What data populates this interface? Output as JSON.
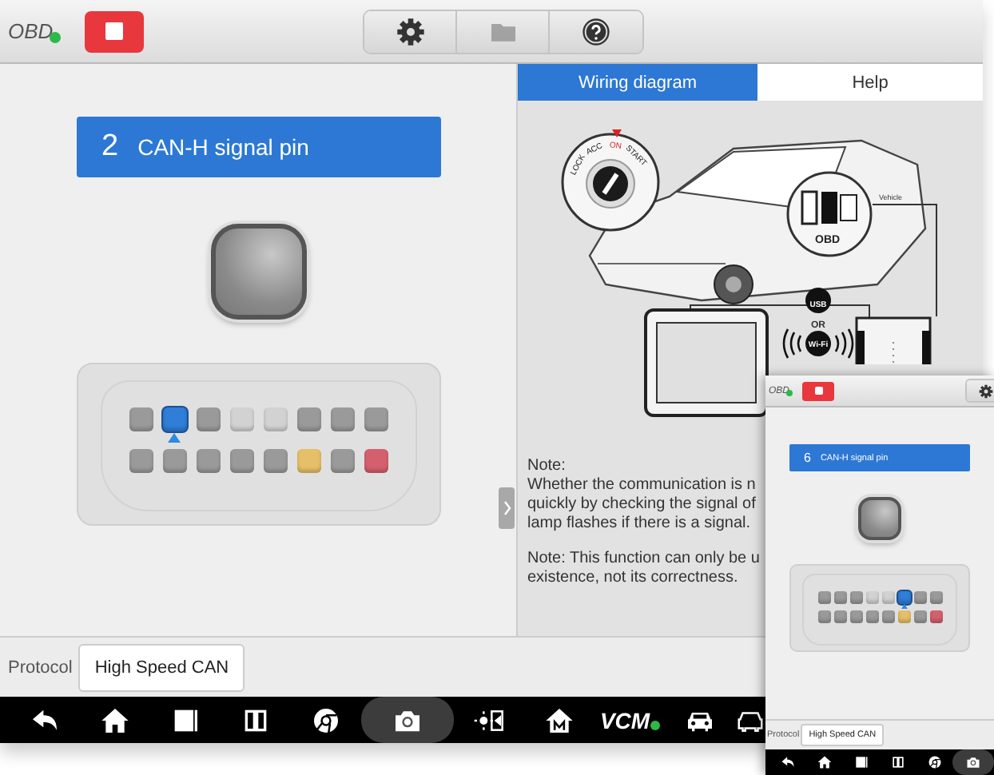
{
  "top_bar": {
    "connection_label": "OBD",
    "connected": true,
    "toolbar": [
      {
        "kind": "settings",
        "disabled": false
      },
      {
        "kind": "folder",
        "disabled": true
      },
      {
        "kind": "help",
        "disabled": false
      }
    ]
  },
  "left_panel": {
    "pin_number": "2",
    "pin_label": "CAN-H signal pin",
    "connector": {
      "pins": [
        {
          "color": "#9a9a9a",
          "selected": false
        },
        {
          "color": "#2f7fd8",
          "selected": true
        },
        {
          "color": "#9a9a9a",
          "selected": false
        },
        {
          "color": "#d2d2d2",
          "selected": false
        },
        {
          "color": "#d2d2d2",
          "selected": false
        },
        {
          "color": "#9a9a9a",
          "selected": false
        },
        {
          "color": "#9a9a9a",
          "selected": false
        },
        {
          "color": "#9a9a9a",
          "selected": false
        },
        {
          "color": "#9a9a9a",
          "selected": false
        },
        {
          "color": "#9a9a9a",
          "selected": false
        },
        {
          "color": "#9a9a9a",
          "selected": false
        },
        {
          "color": "#9a9a9a",
          "selected": false
        },
        {
          "color": "#9a9a9a",
          "selected": false
        },
        {
          "color": "#e6c068",
          "selected": false
        },
        {
          "color": "#9a9a9a",
          "selected": false
        },
        {
          "color": "#d4606e",
          "selected": false
        }
      ]
    }
  },
  "right_panel": {
    "tabs": [
      {
        "label": "Wiring diagram",
        "selected": true
      },
      {
        "label": "Help",
        "selected": false
      }
    ],
    "diagram": {
      "ignition_positions": [
        "LOCK",
        "ACC",
        "ON",
        "START"
      ],
      "port_label": "OBD",
      "cable_label": "Vehicle",
      "usb_label": "USB",
      "or_label": "OR",
      "wifi_label": "Wi-Fi"
    },
    "notes": [
      {
        "lines": [
          "Note:",
          "Whether the communication is n",
          "quickly by checking the signal of",
          "lamp flashes if there is a signal."
        ]
      },
      {
        "lines": [
          "Note: This function can only be u",
          "existence, not its correctness."
        ]
      }
    ]
  },
  "protocol": {
    "label": "Protocol",
    "value": "High Speed CAN"
  },
  "nav_bar": [
    {
      "kind": "back",
      "selected": false
    },
    {
      "kind": "home",
      "selected": false
    },
    {
      "kind": "recents",
      "selected": false
    },
    {
      "kind": "split",
      "selected": false
    },
    {
      "kind": "browser",
      "selected": false
    },
    {
      "kind": "camera",
      "selected": true
    },
    {
      "kind": "display",
      "selected": false
    },
    {
      "kind": "m-home",
      "selected": false
    },
    {
      "kind": "vcm",
      "label": "VCM",
      "selected": false
    },
    {
      "kind": "car",
      "selected": false
    },
    {
      "kind": "car-scan",
      "selected": false
    }
  ],
  "inset": {
    "top_bar": {
      "connection_label": "OBD",
      "connected": true,
      "toolbar": [
        {
          "kind": "settings",
          "disabled": false
        }
      ]
    },
    "left_panel": {
      "pin_number": "6",
      "pin_label": "CAN-H signal pin",
      "connector": {
        "pins": [
          {
            "color": "#9a9a9a",
            "selected": false
          },
          {
            "color": "#9a9a9a",
            "selected": false
          },
          {
            "color": "#9a9a9a",
            "selected": false
          },
          {
            "color": "#d2d2d2",
            "selected": false
          },
          {
            "color": "#d2d2d2",
            "selected": false
          },
          {
            "color": "#2f7fd8",
            "selected": true
          },
          {
            "color": "#9a9a9a",
            "selected": false
          },
          {
            "color": "#9a9a9a",
            "selected": false
          },
          {
            "color": "#9a9a9a",
            "selected": false
          },
          {
            "color": "#9a9a9a",
            "selected": false
          },
          {
            "color": "#9a9a9a",
            "selected": false
          },
          {
            "color": "#9a9a9a",
            "selected": false
          },
          {
            "color": "#9a9a9a",
            "selected": false
          },
          {
            "color": "#e6c068",
            "selected": false
          },
          {
            "color": "#9a9a9a",
            "selected": false
          },
          {
            "color": "#d4606e",
            "selected": false
          }
        ]
      }
    },
    "protocol": {
      "label": "Protocol",
      "value": "High Speed CAN"
    },
    "nav_bar": [
      {
        "kind": "back",
        "selected": false
      },
      {
        "kind": "home",
        "selected": false
      },
      {
        "kind": "recents",
        "selected": false
      },
      {
        "kind": "split",
        "selected": false
      },
      {
        "kind": "browser",
        "selected": false
      },
      {
        "kind": "camera",
        "selected": true
      }
    ]
  }
}
